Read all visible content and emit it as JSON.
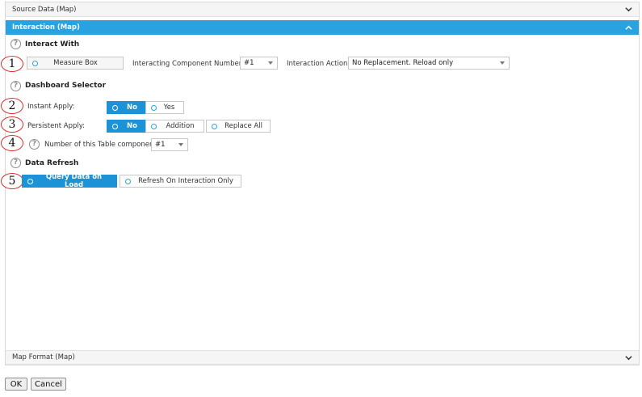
{
  "accordion": {
    "source_data": "Source Data (Map)",
    "interaction": "Interaction (Map)",
    "map_format": "Map Format (Map)"
  },
  "interact_with": {
    "title": "Interact With",
    "measure_box": "Measure Box",
    "component_number_label": "Interacting Component Number:",
    "component_number_value": "#1",
    "action_label": "Interaction Action:",
    "action_value": "No Replacement. Reload only"
  },
  "dashboard_selector": {
    "title": "Dashboard Selector",
    "instant_apply_label": "Instant Apply:",
    "instant_apply_options": [
      "No",
      "Yes"
    ],
    "persistent_apply_label": "Persistent Apply:",
    "persistent_apply_options": [
      "No",
      "Addition",
      "Replace All"
    ],
    "table_component_label": "Number of this Table component",
    "table_component_value": "#1"
  },
  "data_refresh": {
    "title": "Data Refresh",
    "options": [
      "Query Data on Load",
      "Refresh On Interaction Only"
    ]
  },
  "annotations": [
    "1",
    "2",
    "3",
    "4",
    "5"
  ],
  "footer": {
    "ok": "OK",
    "cancel": "Cancel"
  },
  "icons": {
    "help": "?"
  },
  "colors": {
    "accent": "#29a3e0",
    "selected": "#1b93d6",
    "annotation": "#d62f2f"
  }
}
